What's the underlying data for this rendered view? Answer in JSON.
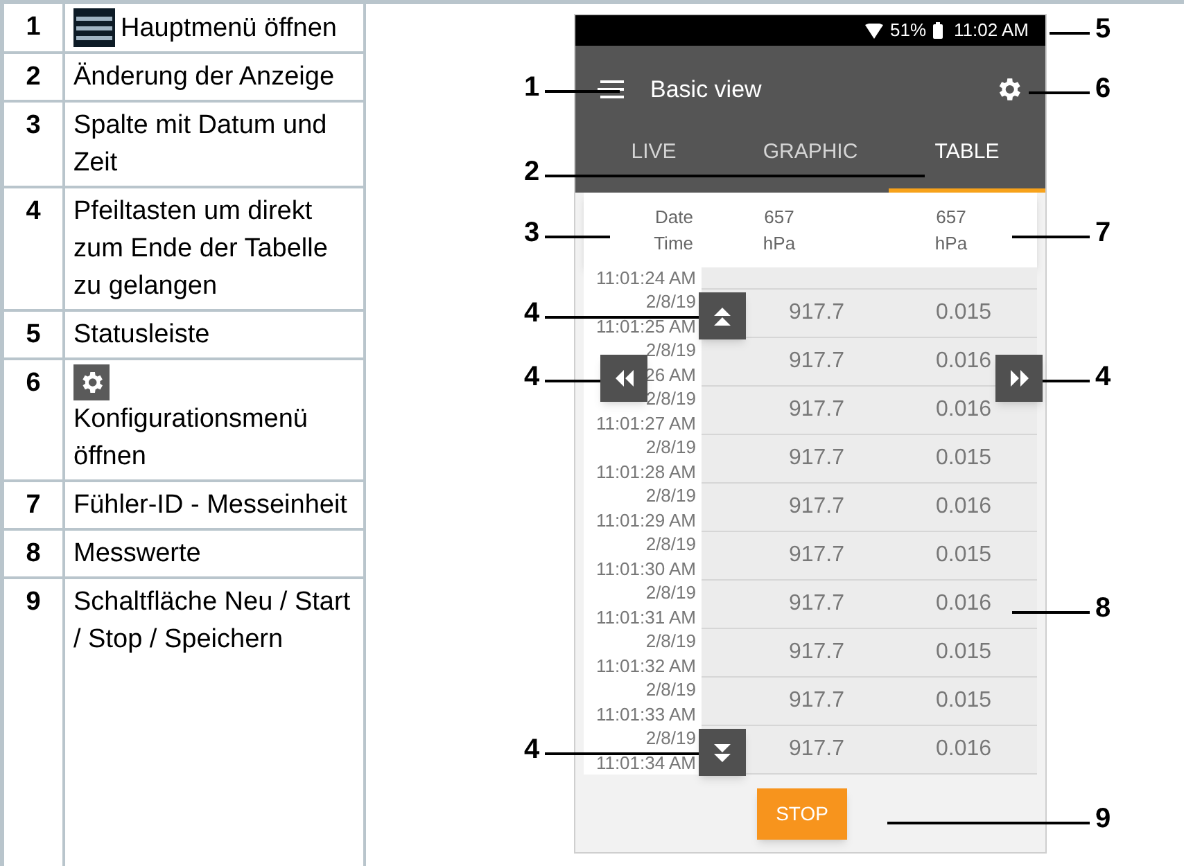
{
  "legend": [
    {
      "number": "1",
      "kind": "menu_icon",
      "text": "Hauptmenü öffnen"
    },
    {
      "number": "2",
      "kind": "text",
      "text": "Änderung der Anzeige"
    },
    {
      "number": "3",
      "kind": "text",
      "text": "Spalte mit Datum und Zeit"
    },
    {
      "number": "4",
      "kind": "text",
      "text": "Pfeiltasten um direkt zum Ende der Tabelle zu gelangen"
    },
    {
      "number": "5",
      "kind": "text",
      "text": "Statusleiste"
    },
    {
      "number": "6",
      "kind": "gear_icon",
      "text": "Konfigurationsmenü öffnen"
    },
    {
      "number": "7",
      "kind": "text",
      "text": "Fühler-ID - Messeinheit"
    },
    {
      "number": "8",
      "kind": "text",
      "text": "Messwerte"
    },
    {
      "number": "9",
      "kind": "text",
      "text": "Schaltfläche Neu / Start / Stop / Speichern"
    }
  ],
  "phone": {
    "status_bar": {
      "battery_percent": "51%",
      "time": "11:02 AM"
    },
    "app_bar": {
      "title": "Basic view"
    },
    "tabs": [
      {
        "label": "LIVE",
        "selected": false
      },
      {
        "label": "GRAPHIC",
        "selected": false
      },
      {
        "label": "TABLE",
        "selected": true
      }
    ],
    "table": {
      "columns": [
        {
          "line_1": "Date",
          "line_2": "Time"
        },
        {
          "line_1": "657",
          "line_2": "hPa"
        },
        {
          "line_1": "657",
          "line_2": "hPa"
        }
      ],
      "rows": [
        {
          "time": "11:01:24 AM"
        },
        {
          "date": "2/8/19",
          "time": "11:01:25 AM",
          "values": [
            "917.7",
            "0.015"
          ]
        },
        {
          "date": "2/8/19",
          "time": "26 AM",
          "values": [
            "917.7",
            "0.016"
          ]
        },
        {
          "date": "2/8/19",
          "time": "11:01:27 AM",
          "values": [
            "917.7",
            "0.016"
          ]
        },
        {
          "date": "2/8/19",
          "time": "11:01:28 AM",
          "values": [
            "917.7",
            "0.015"
          ]
        },
        {
          "date": "2/8/19",
          "time": "11:01:29 AM",
          "values": [
            "917.7",
            "0.016"
          ]
        },
        {
          "date": "2/8/19",
          "time": "11:01:30 AM",
          "values": [
            "917.7",
            "0.015"
          ]
        },
        {
          "date": "2/8/19",
          "time": "11:01:31 AM",
          "values": [
            "917.7",
            "0.016"
          ]
        },
        {
          "date": "2/8/19",
          "time": "11:01:32 AM",
          "values": [
            "917.7",
            "0.015"
          ]
        },
        {
          "date": "2/8/19",
          "time": "11:01:33 AM",
          "values": [
            "917.7",
            "0.015"
          ]
        },
        {
          "date": "2/8/19",
          "time": "11:01:34 AM",
          "values": [
            "917.7",
            "0.016"
          ]
        }
      ]
    },
    "stop_button": {
      "label": "STOP"
    }
  },
  "callouts": [
    {
      "label": "1"
    },
    {
      "label": "2"
    },
    {
      "label": "3"
    },
    {
      "label": "4"
    },
    {
      "label": "4"
    },
    {
      "label": "4"
    },
    {
      "label": "5"
    },
    {
      "label": "6"
    },
    {
      "label": "7"
    },
    {
      "label": "4"
    },
    {
      "label": "8"
    },
    {
      "label": "9"
    }
  ]
}
